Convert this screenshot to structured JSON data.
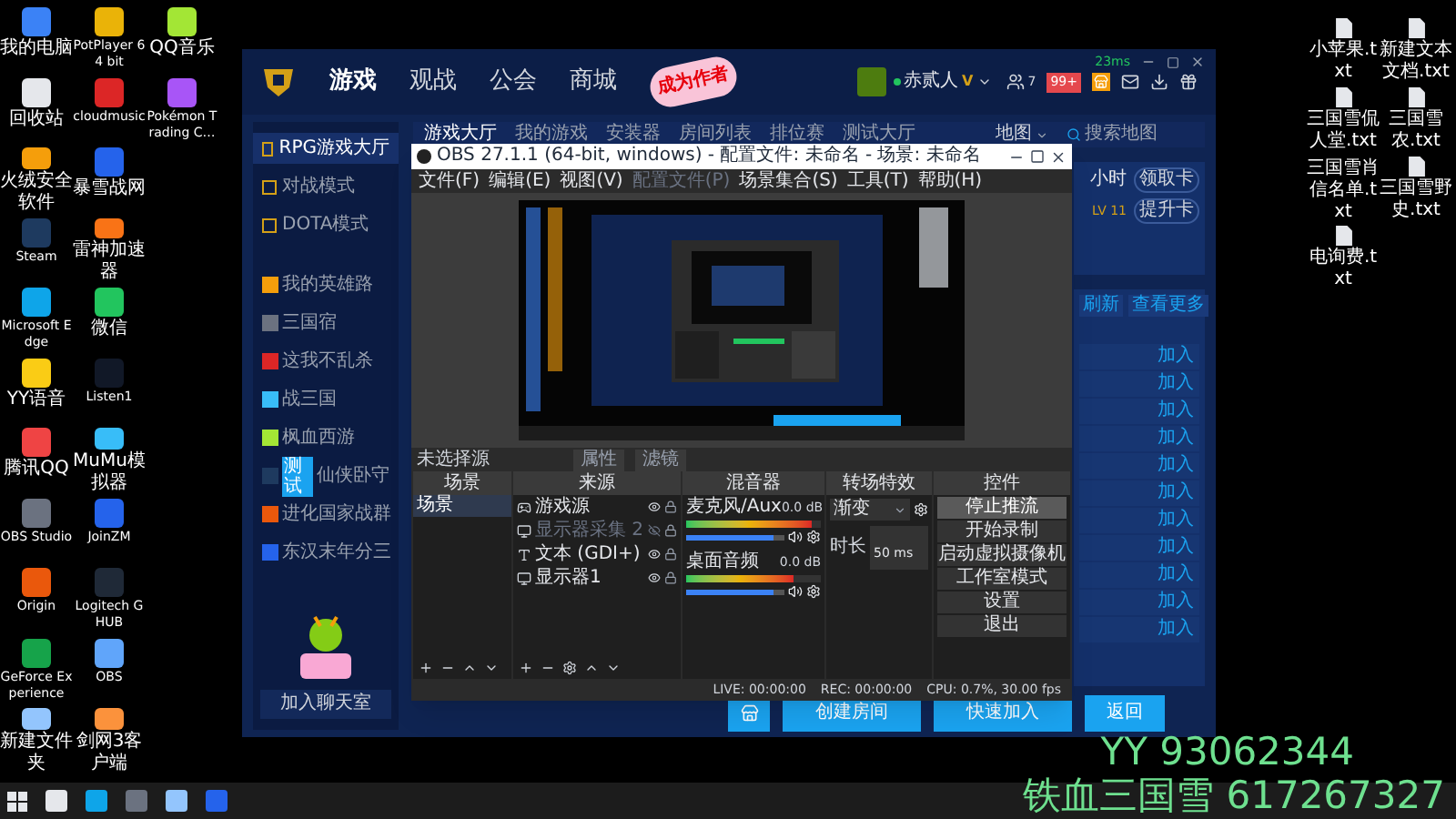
{
  "desktop": {
    "left_icons": [
      {
        "label": "我的电脑"
      },
      {
        "label": "回收站"
      },
      {
        "label": "火绒安全软件"
      },
      {
        "label": "Steam"
      },
      {
        "label": "Microsoft Edge"
      },
      {
        "label": "YY语音"
      },
      {
        "label": "腾讯QQ"
      },
      {
        "label": "OBS Studio"
      },
      {
        "label": "Origin"
      },
      {
        "label": "GeForce Experience"
      },
      {
        "label": "新建文件夹"
      },
      {
        "label": "PotPlayer 64 bit"
      },
      {
        "label": "cloudmusic"
      },
      {
        "label": "暴雪战网"
      },
      {
        "label": "雷神加速器"
      },
      {
        "label": "微信"
      },
      {
        "label": "Listen1"
      },
      {
        "label": "MuMu模拟器"
      },
      {
        "label": "JoinZM"
      },
      {
        "label": "Logitech G HUB"
      },
      {
        "label": "OBS"
      },
      {
        "label": "剑网3客户端"
      },
      {
        "label": "QQ音乐"
      },
      {
        "label": "Pokémon Trading C…"
      }
    ],
    "right_icons": [
      {
        "label": "小苹果.txt"
      },
      {
        "label": "新建文本文档.txt"
      },
      {
        "label": "三国雪侃人堂.txt"
      },
      {
        "label": "三国雪农.txt"
      },
      {
        "label": "三国雪肖信名单.txt"
      },
      {
        "label": "三国雪野史.txt"
      },
      {
        "label": "电询费.txt"
      }
    ]
  },
  "launcher": {
    "nav": [
      {
        "label": "游戏",
        "selected": true
      },
      {
        "label": "观战",
        "selected": false
      },
      {
        "label": "公会",
        "selected": false
      },
      {
        "label": "商城",
        "selected": false
      }
    ],
    "author_badge": "成为作者",
    "user": {
      "name": "赤贰人",
      "vip": "V"
    },
    "friends_count": "7",
    "message_badge": "99+",
    "ping": "23ms",
    "modes": [
      {
        "label": "RPG游戏大厅",
        "selected": true
      },
      {
        "label": "对战模式",
        "selected": false
      },
      {
        "label": "DOTA模式",
        "selected": false
      }
    ],
    "games": [
      {
        "label": "我的英雄路",
        "selected": false
      },
      {
        "label": "三国宿",
        "selected": false
      },
      {
        "label": "这我不乱杀",
        "selected": false
      },
      {
        "label": "战三国",
        "selected": false
      },
      {
        "label": "枫血西游",
        "selected": false
      },
      {
        "label": "仙侠卧守",
        "badge": "测试",
        "selected": false
      },
      {
        "label": "进化国家战群",
        "selected": false
      },
      {
        "label": "东汉末年分三",
        "selected": false
      }
    ],
    "chat_button": "加入聊天室",
    "tabs": [
      {
        "label": "游戏大厅",
        "selected": true
      },
      {
        "label": "我的游戏",
        "selected": false
      },
      {
        "label": "安装器",
        "selected": false
      },
      {
        "label": "房间列表",
        "selected": false
      },
      {
        "label": "排位赛",
        "selected": false
      },
      {
        "label": "测试大厅",
        "selected": false
      }
    ],
    "search": {
      "filter": "地图",
      "placeholder": "搜索地图"
    },
    "side_panel": {
      "hours": "小时",
      "level": "LV 11",
      "card_buttons": [
        "领取卡",
        "提升卡"
      ],
      "room_buttons": [
        "刷新",
        "查看更多"
      ],
      "join_buttons": [
        "加入",
        "加入",
        "加入",
        "加入",
        "加入",
        "加入",
        "加入",
        "加入",
        "加入",
        "加入",
        "加入"
      ]
    },
    "actions": [
      "创建房间",
      "快速加入",
      "返回"
    ]
  },
  "obs": {
    "title": "OBS 27.1.1 (64-bit, windows) - 配置文件: 未命名 - 场景: 未命名",
    "menu": [
      {
        "label": "文件(F)",
        "disabled": false
      },
      {
        "label": "编辑(E)",
        "disabled": false
      },
      {
        "label": "视图(V)",
        "disabled": false
      },
      {
        "label": "配置文件(P)",
        "disabled": true
      },
      {
        "label": "场景集合(S)",
        "disabled": false
      },
      {
        "label": "工具(T)",
        "disabled": false
      },
      {
        "label": "帮助(H)",
        "disabled": false
      }
    ],
    "source_status": "未选择源",
    "source_buttons": [
      "属性",
      "滤镜"
    ],
    "scenes": {
      "title": "场景",
      "items": [
        {
          "label": "场景",
          "selected": true
        }
      ]
    },
    "sources": {
      "title": "来源",
      "items": [
        {
          "label": "游戏源",
          "kind": "game",
          "visible": true
        },
        {
          "label": "显示器采集 2",
          "kind": "monitor",
          "visible": false
        },
        {
          "label": "文本 (GDI+)",
          "kind": "text",
          "visible": true
        },
        {
          "label": "显示器1",
          "kind": "monitor",
          "visible": true
        }
      ]
    },
    "mixer": {
      "title": "混音器",
      "channels": [
        {
          "name": "麦克风/Aux",
          "reading": "0.0 dB",
          "meter": {
            "level": 0.93
          },
          "fader": {
            "level": 0.88
          }
        },
        {
          "name": "桌面音频",
          "reading": "0.0 dB",
          "meter": {
            "level": 0.8
          },
          "fader": {
            "level": 0.88
          }
        }
      ]
    },
    "transition": {
      "title": "转场特效",
      "type": "渐变",
      "duration_label": "时长",
      "duration": "50 ms"
    },
    "controls": {
      "title": "控件",
      "buttons": [
        {
          "label": "停止推流",
          "selected": true
        },
        {
          "label": "开始录制",
          "selected": false
        },
        {
          "label": "启动虚拟摄像机",
          "selected": false
        },
        {
          "label": "工作室模式",
          "selected": false
        },
        {
          "label": "设置",
          "selected": false
        },
        {
          "label": "退出",
          "selected": false
        }
      ]
    },
    "status": {
      "live": "LIVE: 00:00:00",
      "rec": "REC: 00:00:00",
      "cpu": "CPU: 0.7%, 30.00 fps"
    }
  },
  "overlay": [
    "YY 93062344",
    "铁血三国雪 617267327"
  ]
}
